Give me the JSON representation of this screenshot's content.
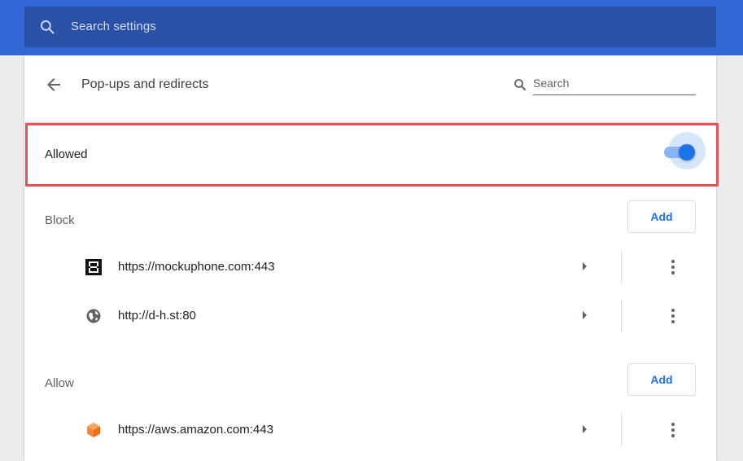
{
  "top_search": {
    "placeholder": "Search settings",
    "icon": "search-icon"
  },
  "header": {
    "title": "Pop-ups and redirects",
    "back_icon": "back-arrow-icon",
    "search_placeholder": "Search"
  },
  "allowed_toggle": {
    "label": "Allowed",
    "state": "on",
    "highlighted": true
  },
  "block": {
    "label": "Block",
    "add_label": "Add",
    "sites": [
      {
        "url": "https://mockuphone.com:443",
        "favicon": "mockuphone-favicon"
      },
      {
        "url": "http://d-h.st:80",
        "favicon": "globe-icon"
      }
    ]
  },
  "allow": {
    "label": "Allow",
    "add_label": "Add",
    "sites": [
      {
        "url": "https://aws.amazon.com:443",
        "favicon": "aws-favicon"
      }
    ]
  },
  "colors": {
    "top_bar": "#3367d6",
    "search_box": "#2a51a5",
    "accent": "#1a73e8",
    "highlight_border": "#e2535a"
  }
}
